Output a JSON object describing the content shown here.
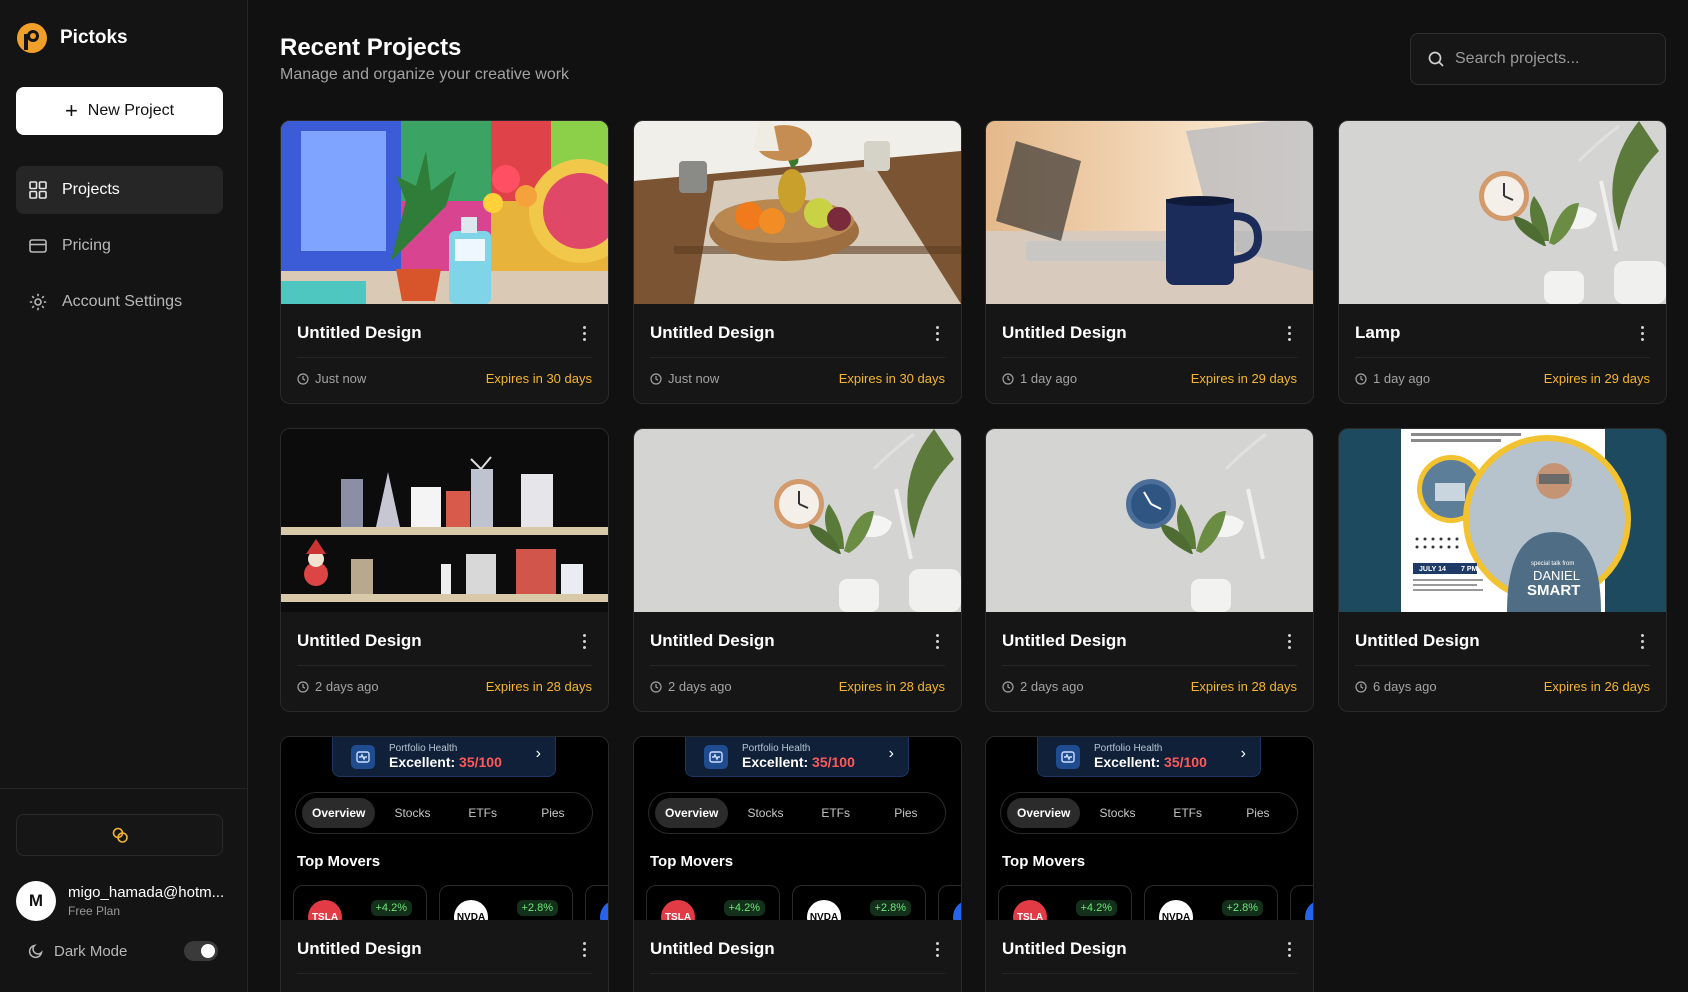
{
  "app": {
    "name": "Pictoks"
  },
  "sidebar": {
    "new_project_label": "New Project",
    "nav": [
      {
        "label": "Projects",
        "icon": "grid-icon",
        "active": true
      },
      {
        "label": "Pricing",
        "icon": "credit-card-icon",
        "active": false
      },
      {
        "label": "Account Settings",
        "icon": "gear-icon",
        "active": false
      }
    ],
    "credits_icon": "coins-icon",
    "user": {
      "initial": "M",
      "email": "migo_hamada@hotm...",
      "plan": "Free Plan"
    },
    "dark_mode": {
      "label": "Dark Mode",
      "enabled": true
    }
  },
  "header": {
    "title": "Recent Projects",
    "subtitle": "Manage and organize your creative work",
    "search_placeholder": "Search projects..."
  },
  "projects": [
    {
      "title": "Untitled Design",
      "time": "Just now",
      "expires": "Expires in 30 days",
      "thumb": "colorful-flowers"
    },
    {
      "title": "Untitled Design",
      "time": "Just now",
      "expires": "Expires in 30 days",
      "thumb": "fruit-bowl"
    },
    {
      "title": "Untitled Design",
      "time": "1 day ago",
      "expires": "Expires in 29 days",
      "thumb": "mug-laptop"
    },
    {
      "title": "Lamp",
      "time": "1 day ago",
      "expires": "Expires in 29 days",
      "thumb": "wall-clock-lamp"
    },
    {
      "title": "Untitled Design",
      "time": "2 days ago",
      "expires": "Expires in 28 days",
      "thumb": "holiday-shelves"
    },
    {
      "title": "Untitled Design",
      "time": "2 days ago",
      "expires": "Expires in 28 days",
      "thumb": "wall-clock-lamp"
    },
    {
      "title": "Untitled Design",
      "time": "2 days ago",
      "expires": "Expires in 28 days",
      "thumb": "blue-clock-lamp"
    },
    {
      "title": "Untitled Design",
      "time": "6 days ago",
      "expires": "Expires in 26 days",
      "thumb": "speaker-flyer",
      "flyer": {
        "date": "JULY 14",
        "time": "7 PM",
        "tagline": "special talk from",
        "first": "DANIEL",
        "last": "SMART"
      }
    },
    {
      "title": "Untitled Design",
      "thumb": "portfolio-app"
    },
    {
      "title": "Untitled Design",
      "thumb": "portfolio-app"
    },
    {
      "title": "Untitled Design",
      "thumb": "portfolio-app"
    }
  ],
  "portfolio_mock": {
    "health_label": "Portfolio Health",
    "health_prefix": "Excellent:",
    "health_value": "35/100",
    "tabs": [
      "Overview",
      "Stocks",
      "ETFs",
      "Pies"
    ],
    "movers_title": "Top Movers",
    "movers": [
      {
        "ticker": "TSLA",
        "change": "+4.2%"
      },
      {
        "ticker": "NVDA",
        "change": "+2.8%"
      }
    ]
  },
  "colors": {
    "accent": "#f5b52e",
    "brand": "#f0a028",
    "background": "#111111"
  }
}
